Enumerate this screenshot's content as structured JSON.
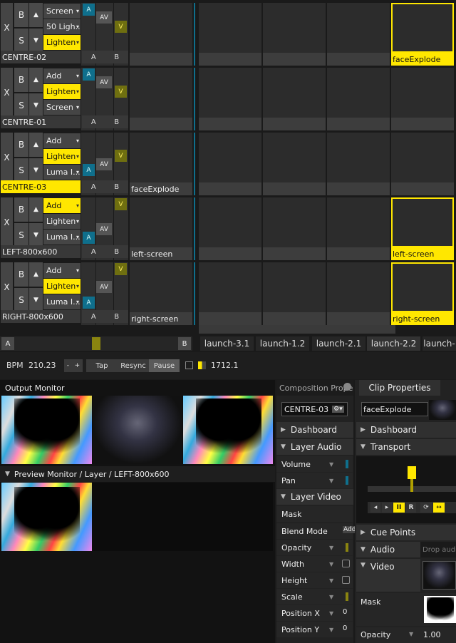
{
  "layers": [
    {
      "name": "CENTRE-02",
      "blends": [
        "Screen",
        "50 Ligh...",
        "Lighten"
      ],
      "selected_blend": 2,
      "name_highlight": false,
      "ab": [
        "A",
        "B"
      ],
      "clip": {
        "col": 3,
        "label": "faceExplode",
        "thumb": "face",
        "selected": true
      }
    },
    {
      "name": "CENTRE-01",
      "blends": [
        "Add",
        "Lighten",
        "Screen"
      ],
      "selected_blend": 1,
      "name_highlight": false,
      "ab": [
        "A",
        "B"
      ],
      "clip": null
    },
    {
      "name": "CENTRE-03",
      "blends": [
        "Add",
        "Lighten",
        "Luma I..."
      ],
      "selected_blend": 1,
      "name_highlight": true,
      "ab": [
        "A",
        "B"
      ],
      "clip": {
        "col": 0,
        "label": "faceExplode",
        "thumb": "face",
        "selected": false
      }
    },
    {
      "name": "LEFT-800x600",
      "blends": [
        "Add",
        "Lighten",
        "Luma I..."
      ],
      "selected_blend": 0,
      "name_highlight": false,
      "ab": [
        "A",
        "B"
      ],
      "clip": {
        "col": 0,
        "label": "left-screen",
        "thumb": "rgb",
        "selected": false
      },
      "clip2": {
        "col": 3,
        "label": "left-screen",
        "thumb": "rgb",
        "selected": true
      }
    },
    {
      "name": "RIGHT-800x600",
      "blends": [
        "Add",
        "Lighten",
        "Luma I..."
      ],
      "selected_blend": 1,
      "name_highlight": false,
      "ab": [
        "A",
        "B"
      ],
      "clip": {
        "col": 0,
        "label": "right-screen",
        "thumb": "rgb",
        "selected": false
      },
      "clip2": {
        "col": 3,
        "label": "right-screen",
        "thumb": "rgb",
        "selected": true
      }
    }
  ],
  "layer_buttons": {
    "x": "X",
    "b": "B",
    "s": "S",
    "up": "▲",
    "down": "▼",
    "a": "A",
    "av": "AV",
    "v": "V"
  },
  "crossfader": {
    "a": "A",
    "b": "B"
  },
  "deck_tabs": [
    "launch-3.1",
    "launch-1.2",
    "launch-2.1",
    "launch-2.2",
    "launch-"
  ],
  "bpm": {
    "label": "BPM",
    "value": "210.23",
    "minus": "-",
    "plus": "+",
    "tap": "Tap",
    "resync": "Resync",
    "pause": "Pause",
    "beats": "1712.1"
  },
  "output_monitor": {
    "title": "Output Monitor"
  },
  "preview_monitor": {
    "title": "Preview Monitor / Layer / LEFT-800x600"
  },
  "composition": {
    "tab": "Composition Propert",
    "layer_select": "CENTRE-03",
    "sections": {
      "dashboard": "Dashboard",
      "layer_audio": "Layer Audio",
      "layer_video": "Layer Video"
    },
    "rows": [
      {
        "label": "Volume",
        "dd": true,
        "ind": "blue"
      },
      {
        "label": "Pan",
        "dd": true,
        "ind": "blue"
      },
      {
        "label": "Mask",
        "dd": false,
        "ind": null
      },
      {
        "label": "Blend Mode",
        "dd": false,
        "ind": "Add"
      },
      {
        "label": "Opacity",
        "dd": true,
        "ind": "yellow"
      },
      {
        "label": "Width",
        "dd": true,
        "ind": "box"
      },
      {
        "label": "Height",
        "dd": true,
        "ind": "box"
      },
      {
        "label": "Scale",
        "dd": true,
        "ind": "yellow"
      },
      {
        "label": "Position X",
        "dd": true,
        "ind": "0"
      },
      {
        "label": "Position Y",
        "dd": true,
        "ind": "0"
      }
    ]
  },
  "clip_props": {
    "tab": "Clip Properties",
    "clip_name": "faceExplode",
    "dashboard": "Dashboard",
    "transport": "Transport",
    "cue_points": "Cue Points",
    "audio": "Audio",
    "audio_drop": "Drop audio",
    "video": "Video",
    "mask": "Mask",
    "opacity_label": "Opacity",
    "opacity_value": "1.00",
    "transport_buttons": [
      "◂",
      "▸",
      "II",
      "R"
    ],
    "playhead_fraction": 0.6
  },
  "colors": {
    "yellow": "#ffe700",
    "blue": "#0f6f8c",
    "bg": "#1a1a1a"
  }
}
